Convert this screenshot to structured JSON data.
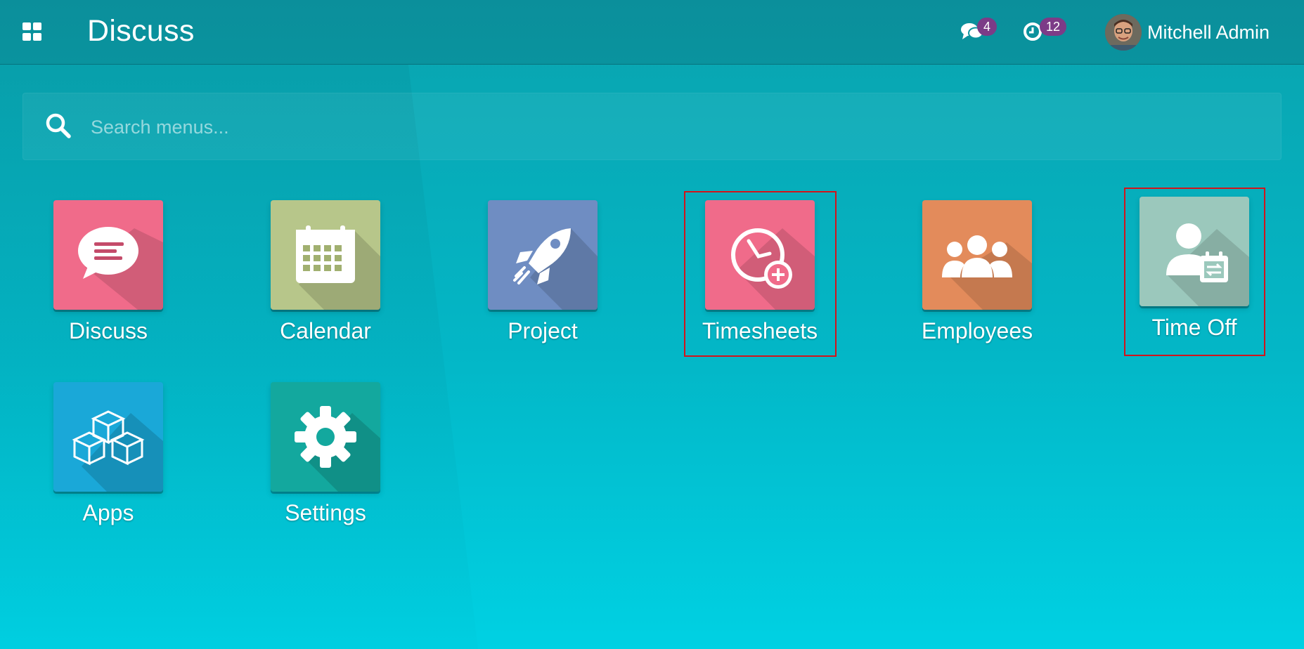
{
  "topbar": {
    "app_title": "Discuss",
    "messages_badge": "4",
    "activities_badge": "12",
    "user_name": "Mitchell Admin"
  },
  "search": {
    "placeholder": "Search menus...",
    "value": ""
  },
  "apps": [
    {
      "label": "Discuss",
      "color": "#f06b8a",
      "icon": "chat-bubble-icon"
    },
    {
      "label": "Calendar",
      "color": "#b7c68a",
      "icon": "calendar-icon"
    },
    {
      "label": "Project",
      "color": "#6f8dc2",
      "icon": "rocket-icon"
    },
    {
      "label": "Timesheets",
      "color": "#f06b8a",
      "icon": "clock-plus-icon"
    },
    {
      "label": "Employees",
      "color": "#e38b5b",
      "icon": "people-icon"
    },
    {
      "label": "Time Off",
      "color": "#9bc8bc",
      "icon": "person-calendar-icon"
    },
    {
      "label": "Apps",
      "color": "#1aa8d8",
      "icon": "cubes-icon"
    },
    {
      "label": "Settings",
      "color": "#13a89e",
      "icon": "gear-icon"
    }
  ]
}
